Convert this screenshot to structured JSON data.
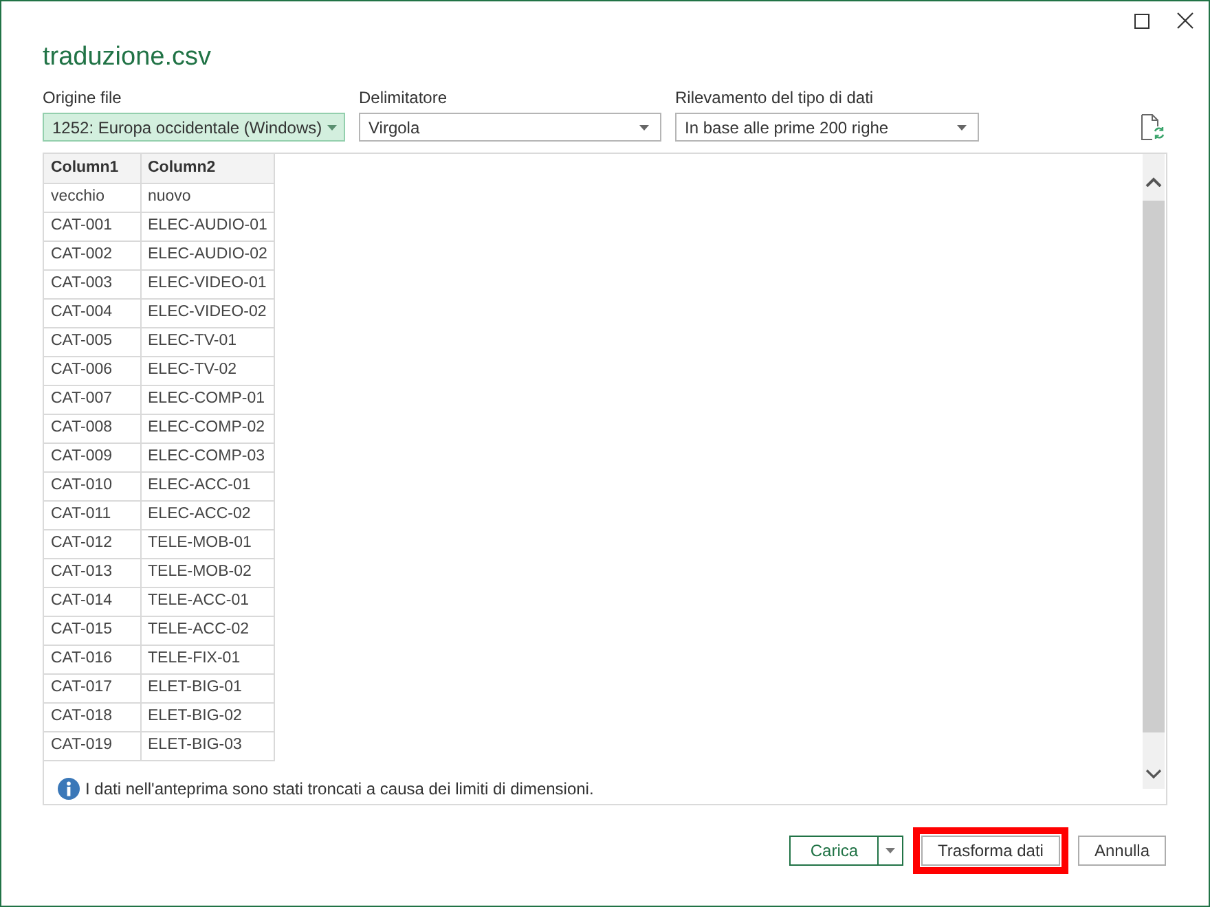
{
  "window": {
    "title": "traduzione.csv"
  },
  "options": [
    {
      "label": "Origine file",
      "value": "1252: Europa occidentale (Windows)",
      "focused": true
    },
    {
      "label": "Delimitatore",
      "value": "Virgola",
      "focused": false
    },
    {
      "label": "Rilevamento del tipo di dati",
      "value": "In base alle prime 200 righe",
      "focused": false
    }
  ],
  "table": {
    "columns": [
      "Column1",
      "Column2"
    ],
    "rows": [
      [
        "vecchio",
        "nuovo"
      ],
      [
        "CAT-001",
        "ELEC-AUDIO-01"
      ],
      [
        "CAT-002",
        "ELEC-AUDIO-02"
      ],
      [
        "CAT-003",
        "ELEC-VIDEO-01"
      ],
      [
        "CAT-004",
        "ELEC-VIDEO-02"
      ],
      [
        "CAT-005",
        "ELEC-TV-01"
      ],
      [
        "CAT-006",
        "ELEC-TV-02"
      ],
      [
        "CAT-007",
        "ELEC-COMP-01"
      ],
      [
        "CAT-008",
        "ELEC-COMP-02"
      ],
      [
        "CAT-009",
        "ELEC-COMP-03"
      ],
      [
        "CAT-010",
        "ELEC-ACC-01"
      ],
      [
        "CAT-011",
        "ELEC-ACC-02"
      ],
      [
        "CAT-012",
        "TELE-MOB-01"
      ],
      [
        "CAT-013",
        "TELE-MOB-02"
      ],
      [
        "CAT-014",
        "TELE-ACC-01"
      ],
      [
        "CAT-015",
        "TELE-ACC-02"
      ],
      [
        "CAT-016",
        "TELE-FIX-01"
      ],
      [
        "CAT-017",
        "ELET-BIG-01"
      ],
      [
        "CAT-018",
        "ELET-BIG-02"
      ],
      [
        "CAT-019",
        "ELET-BIG-03"
      ]
    ]
  },
  "notice": "I dati nell'anteprima sono stati troncati a causa dei limiti di dimensioni.",
  "buttons": [
    {
      "kind": "split",
      "label": "Carica",
      "highlighted": false
    },
    {
      "kind": "plain",
      "label": "Trasforma dati",
      "highlighted": true
    },
    {
      "kind": "plain",
      "label": "Annulla",
      "highlighted": false
    }
  ]
}
